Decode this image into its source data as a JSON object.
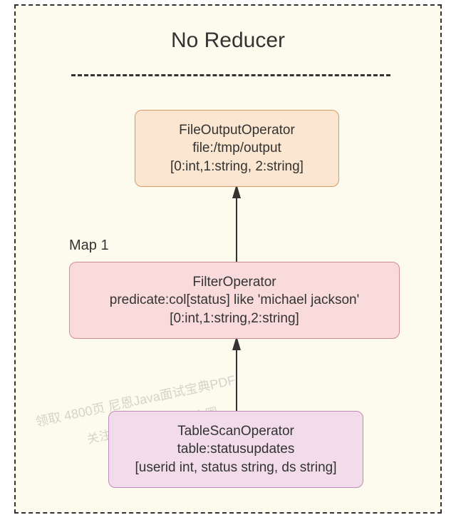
{
  "title": "No Reducer",
  "map_label": "Map 1",
  "nodes": {
    "output": {
      "name": "FileOutputOperator",
      "prop": "file:/tmp/output",
      "schema": "[0:int,1:string, 2:string]"
    },
    "filter": {
      "name": "FilterOperator",
      "prop": "predicate:col[status] like 'michael jackson'",
      "schema": "[0:int,1:string,2:string]"
    },
    "scan": {
      "name": "TableScanOperator",
      "prop": "table:statusupdates",
      "schema": "[userid int, status string, ds string]"
    }
  },
  "watermark": {
    "line1": "领取 4800页 尼恩Java面试宝典PDF",
    "line2": "关注公众号：技术自由圈"
  },
  "chart_data": {
    "type": "dag",
    "title": "No Reducer",
    "stage": "Map 1",
    "flow": [
      "TableScanOperator",
      "FilterOperator",
      "FileOutputOperator"
    ],
    "operators": [
      {
        "id": "TableScanOperator",
        "table": "statusupdates",
        "columns": [
          {
            "name": "userid",
            "type": "int"
          },
          {
            "name": "status",
            "type": "string"
          },
          {
            "name": "ds",
            "type": "string"
          }
        ]
      },
      {
        "id": "FilterOperator",
        "predicate": "col[status] like 'michael jackson'",
        "output_schema": [
          "0:int",
          "1:string",
          "2:string"
        ]
      },
      {
        "id": "FileOutputOperator",
        "file": "/tmp/output",
        "output_schema": [
          "0:int",
          "1:string",
          "2:string"
        ]
      }
    ]
  }
}
